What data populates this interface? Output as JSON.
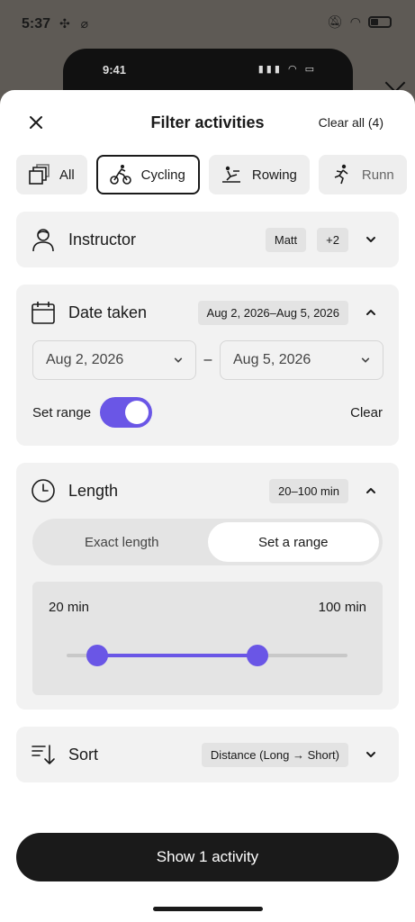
{
  "background": {
    "time": "5:37",
    "left_icons": "✣ ⌀",
    "phone_time": "9:41",
    "phone_icons": "▮▮▮ ◠ ▭"
  },
  "header": {
    "title": "Filter activities",
    "clear_all": "Clear all (4)"
  },
  "chips": [
    {
      "label": "All",
      "icon": "stack-icon",
      "selected": false
    },
    {
      "label": "Cycling",
      "icon": "cycling-icon",
      "selected": true
    },
    {
      "label": "Rowing",
      "icon": "rowing-icon",
      "selected": false
    },
    {
      "label": "Runn",
      "icon": "running-icon",
      "selected": false
    }
  ],
  "instructor": {
    "title": "Instructor",
    "pill1": "Matt",
    "pill2": "+2"
  },
  "date": {
    "title": "Date taken",
    "summary": "Aug 2, 2026–Aug 5, 2026",
    "start": "Aug 2, 2026",
    "dash": "–",
    "end": "Aug 5, 2026",
    "set_range_label": "Set range",
    "set_range_on": true,
    "clear": "Clear"
  },
  "length": {
    "title": "Length",
    "summary": "20–100 min",
    "tab_exact": "Exact length",
    "tab_range": "Set a range",
    "active_tab": "range",
    "min_label": "20 min",
    "max_label": "100 min",
    "range_fraction": {
      "low": 0.11,
      "high": 0.68
    }
  },
  "sort": {
    "title": "Sort",
    "value": "Distance (Long → Short)"
  },
  "cta": {
    "label": "Show 1 activity"
  },
  "colors": {
    "accent": "#6a56e6",
    "card": "#f2f2f2",
    "dark": "#1a1a1a"
  }
}
